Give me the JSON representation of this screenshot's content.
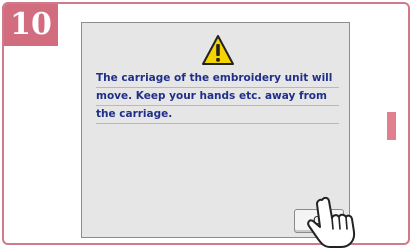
{
  "step": {
    "number": "10"
  },
  "dialog": {
    "icon": "warning-icon",
    "message_lines": [
      "The carriage of the embroidery unit will",
      "move. Keep your hands etc. away from",
      "the carriage."
    ],
    "ok_label": "O"
  },
  "colors": {
    "accent": "#d26d80",
    "message_text": "#1f2f8a",
    "dialog_bg": "#e6e6e6",
    "warning_yellow": "#f5d400"
  }
}
